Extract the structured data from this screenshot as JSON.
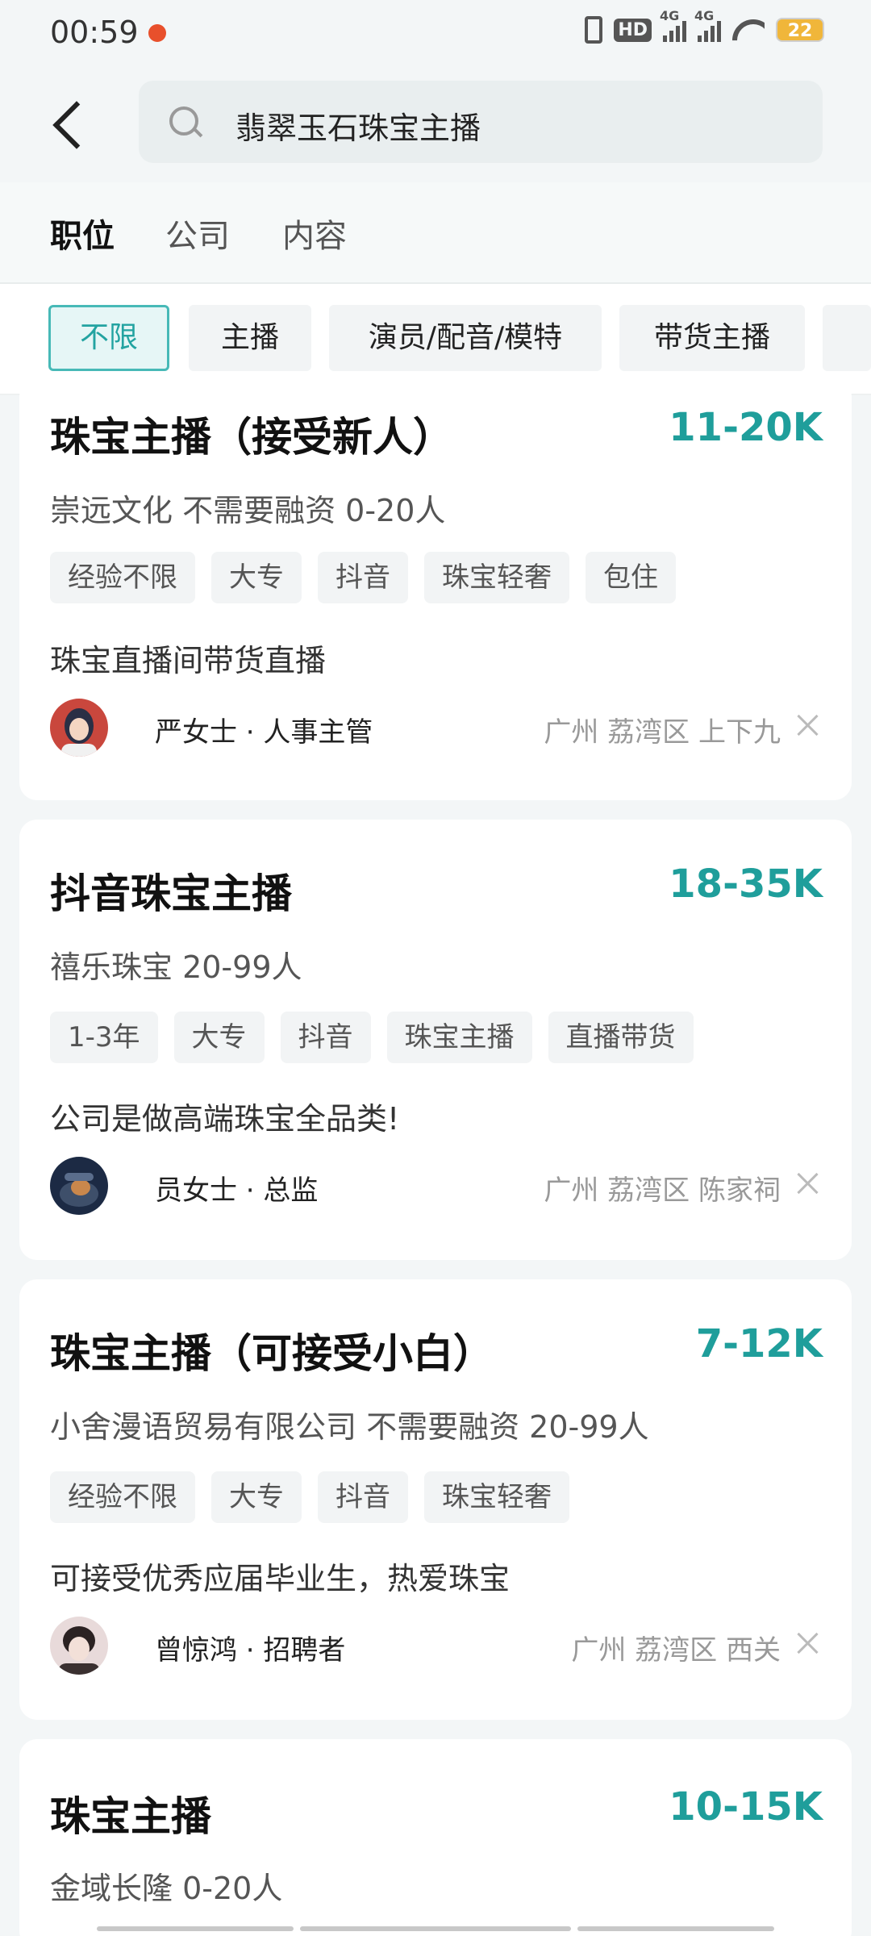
{
  "status_bar": {
    "time": "00:59",
    "hd_label": "HD",
    "signal1_label": "4G",
    "signal2_label": "4G",
    "battery": "22"
  },
  "search": {
    "query": "翡翠玉石珠宝主播"
  },
  "tabs": [
    {
      "label": "职位",
      "active": true
    },
    {
      "label": "公司",
      "active": false
    },
    {
      "label": "内容",
      "active": false
    }
  ],
  "filters": [
    {
      "label": "不限",
      "active": true
    },
    {
      "label": "主播",
      "active": false
    },
    {
      "label": "演员/配音/模特",
      "active": false
    },
    {
      "label": "带货主播",
      "active": false
    }
  ],
  "jobs": [
    {
      "title": "珠宝主播（接受新人）",
      "salary": "11-20K",
      "company": "崇远文化  不需要融资  0-20人",
      "tags": [
        "经验不限",
        "大专",
        "抖音",
        "珠宝轻奢",
        "包住"
      ],
      "description": "珠宝直播间带货直播",
      "recruiter": "严女士 · 人事主管",
      "location": "广州  荔湾区  上下九"
    },
    {
      "title": "抖音珠宝主播",
      "salary": "18-35K",
      "company": "禧乐珠宝  20-99人",
      "tags": [
        "1-3年",
        "大专",
        "抖音",
        "珠宝主播",
        "直播带货"
      ],
      "description": "公司是做高端珠宝全品类!",
      "recruiter": "员女士 · 总监",
      "location": "广州  荔湾区  陈家祠"
    },
    {
      "title": "珠宝主播（可接受小白）",
      "salary": "7-12K",
      "company": "小舍漫语贸易有限公司  不需要融资  20-99人",
      "tags": [
        "经验不限",
        "大专",
        "抖音",
        "珠宝轻奢"
      ],
      "description": "可接受优秀应届毕业生，热爱珠宝",
      "recruiter": "曾惊鸿 · 招聘者",
      "location": "广州  荔湾区  西关"
    },
    {
      "title": "珠宝主播",
      "salary": "10-15K",
      "company": "金域长隆  0-20人"
    }
  ],
  "colors": {
    "accent": "#1f9e9b",
    "background": "#f3f6f7"
  }
}
